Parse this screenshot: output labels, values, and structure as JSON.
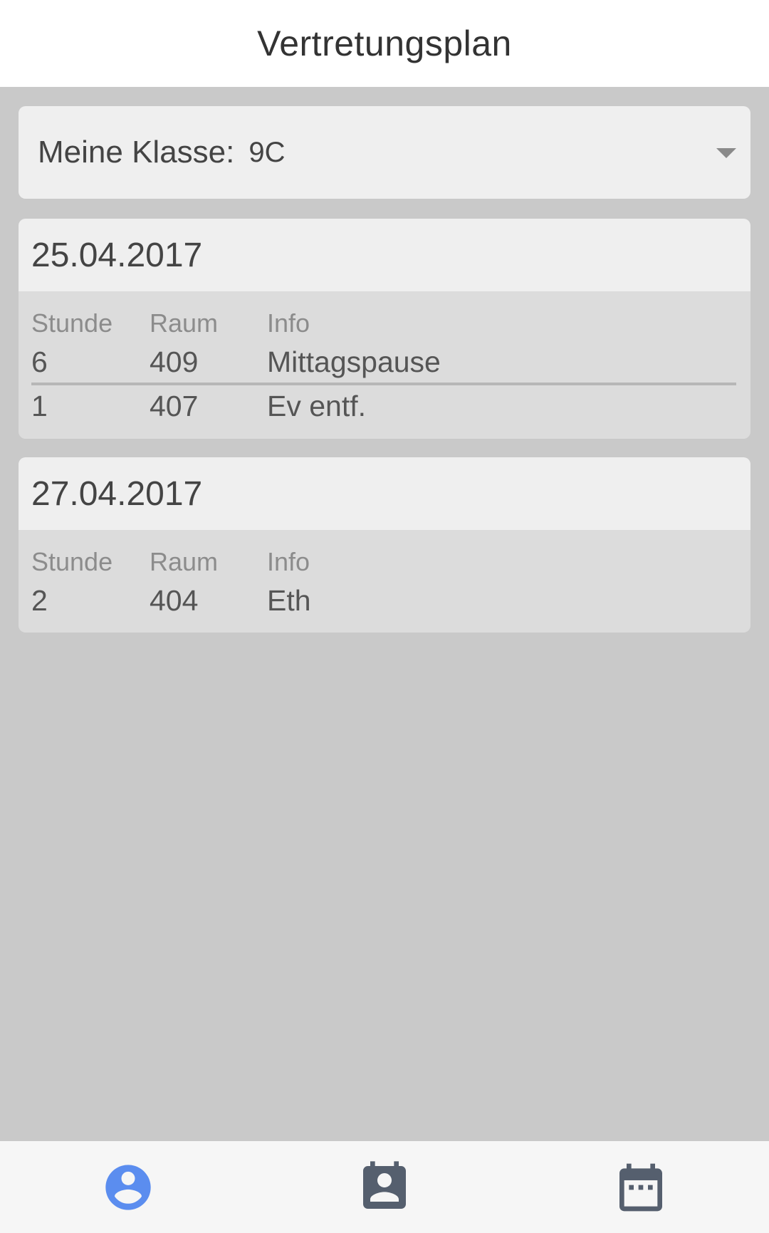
{
  "header": {
    "title": "Vertretungsplan"
  },
  "class_selector": {
    "label": "Meine Klasse:",
    "value": "9C"
  },
  "days": [
    {
      "date": "25.04.2017",
      "columns": [
        "Stunde",
        "Raum",
        "Info"
      ],
      "rows": [
        {
          "stunde": "6",
          "raum": "409",
          "info": "Mittagspause"
        },
        {
          "stunde": "1",
          "raum": "407",
          "info": "Ev entf."
        }
      ]
    },
    {
      "date": "27.04.2017",
      "columns": [
        "Stunde",
        "Raum",
        "Info"
      ],
      "rows": [
        {
          "stunde": "2",
          "raum": "404",
          "info": "Eth"
        }
      ]
    }
  ],
  "nav": {
    "items": [
      {
        "icon": "account-circle-icon",
        "active": true
      },
      {
        "icon": "contact-calendar-icon",
        "active": false
      },
      {
        "icon": "calendar-icon",
        "active": false
      }
    ],
    "active_color": "#5b8def",
    "inactive_color": "#555f6e"
  }
}
